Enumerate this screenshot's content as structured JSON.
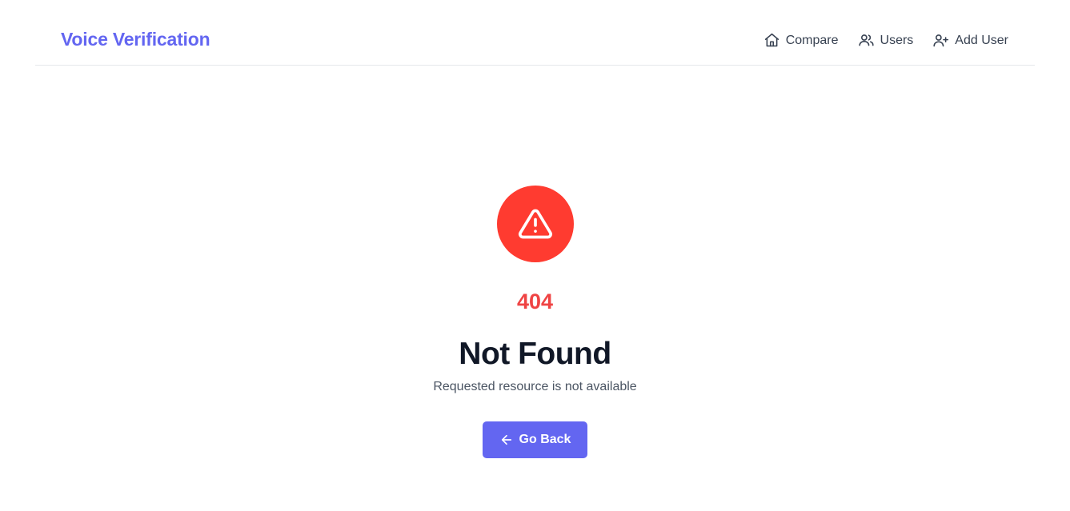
{
  "header": {
    "brand": "Voice Verification",
    "nav": [
      {
        "label": "Compare",
        "icon": "home-icon"
      },
      {
        "label": "Users",
        "icon": "users-icon"
      },
      {
        "label": "Add User",
        "icon": "user-plus-icon"
      }
    ]
  },
  "error": {
    "icon": "warning-triangle-icon",
    "code": "404",
    "title": "Not Found",
    "message": "Requested resource is not available",
    "button_label": "Go Back",
    "button_icon": "arrow-left-icon"
  },
  "colors": {
    "accent": "#6366f1",
    "error": "#ff3b30",
    "code": "#ef4444",
    "text": "#111827",
    "muted": "#4b5563"
  }
}
